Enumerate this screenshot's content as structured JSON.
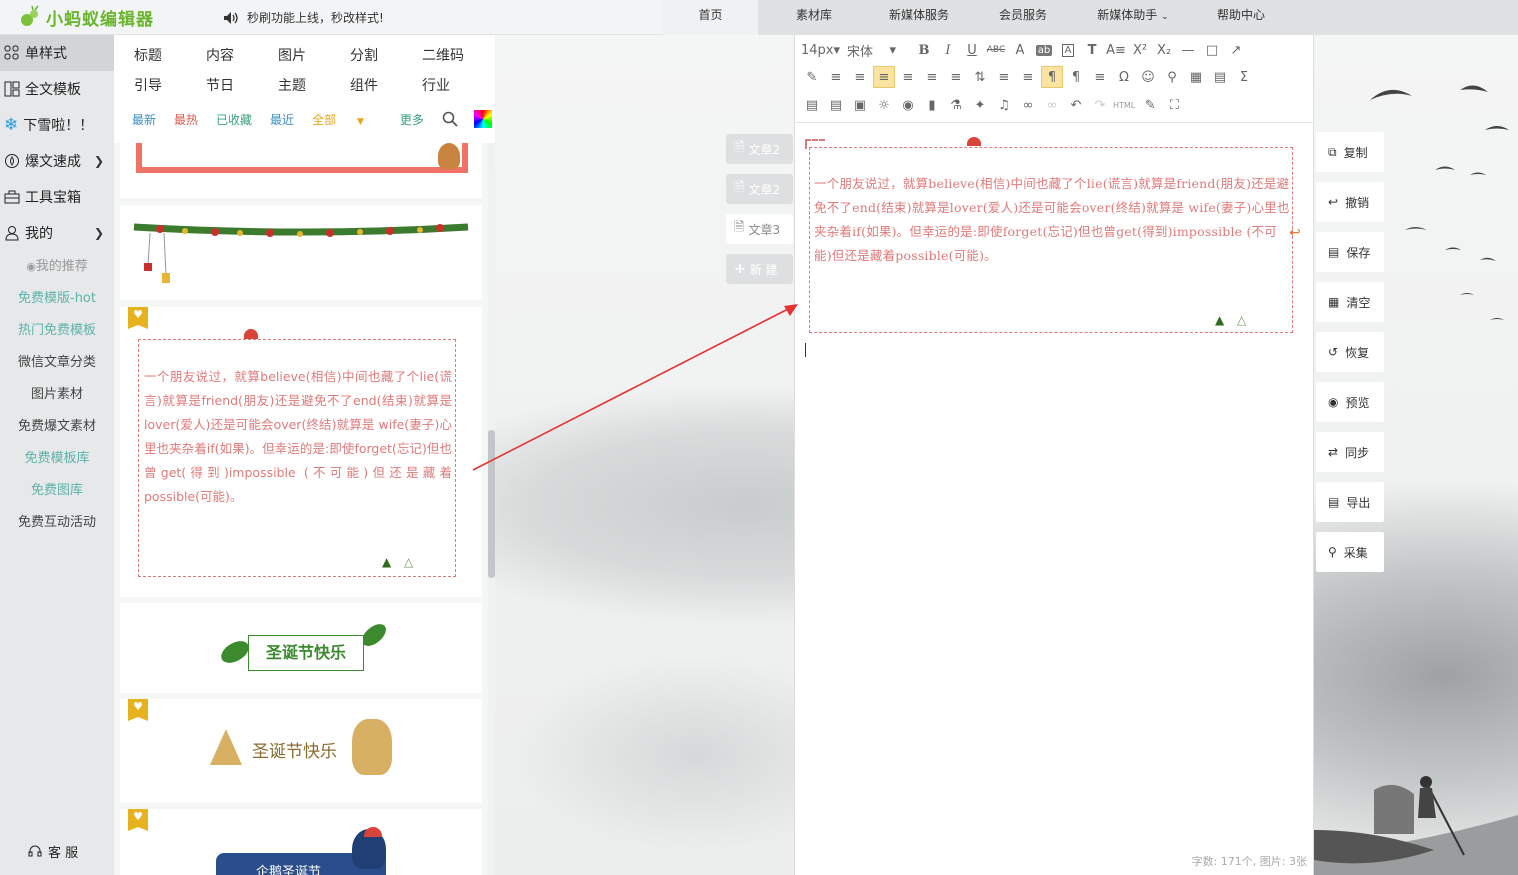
{
  "app": {
    "logo_text": "小蚂蚁编辑器",
    "notice": "秒刷功能上线，秒改样式!"
  },
  "nav": [
    {
      "label": "首页",
      "active": true
    },
    {
      "label": "素材库"
    },
    {
      "label": "新媒体服务"
    },
    {
      "label": "会员服务"
    },
    {
      "label": "新媒体助手",
      "has_dropdown": true
    },
    {
      "label": "帮助中心"
    }
  ],
  "leftnav": {
    "items": [
      {
        "label": "单样式",
        "icon": "grid-icon",
        "active": true
      },
      {
        "label": "全文模板",
        "icon": "template-icon"
      },
      {
        "label": "下雪啦！！",
        "icon": "snowflake-icon"
      },
      {
        "label": "爆文速成",
        "icon": "fire-icon",
        "chevron": true
      },
      {
        "label": "工具宝箱",
        "icon": "toolbox-icon"
      },
      {
        "label": "我的",
        "icon": "user-icon",
        "chevron": true
      }
    ],
    "subitems": [
      {
        "label": "我的推荐",
        "color": "#999999",
        "icon": "eye-icon"
      },
      {
        "label": "免费模版-hot",
        "color": "#5db3a8"
      },
      {
        "label": "热门免费模板",
        "color": "#5db3a8"
      },
      {
        "label": "微信文章分类",
        "color": "#444444"
      },
      {
        "label": "图片素材",
        "color": "#444444"
      },
      {
        "label": "免费爆文素材",
        "color": "#444444"
      },
      {
        "label": "免费模板库",
        "color": "#5db3a8"
      },
      {
        "label": "免费图库",
        "color": "#5db3a8"
      },
      {
        "label": "免费互动活动",
        "color": "#444444"
      }
    ],
    "service": "客 服"
  },
  "categories": [
    [
      "标题",
      "内容",
      "图片",
      "分割",
      "二维码"
    ],
    [
      "引导",
      "节日",
      "主题",
      "组件",
      "行业"
    ]
  ],
  "filters": [
    {
      "label": "最新",
      "color": "#3a8fc7"
    },
    {
      "label": "最热",
      "color": "#e05b4b"
    },
    {
      "label": "已收藏",
      "color": "#3aa17e"
    },
    {
      "label": "最近",
      "color": "#3a8fc7"
    },
    {
      "label": "全部",
      "color": "#e8a317",
      "dropdown": true
    },
    {
      "label": "更多",
      "color": "#3aa17e"
    }
  ],
  "article_text": "一个朋友说过，就算believe(相信)中间也藏了个lie(谎言)就算是friend(朋友)还是避免不了end(结束)就算是lover(爱人)还是可能会over(终结)就算是 wife(妻子)心里也夹杂着if(如果)。但幸运的是:即使forget(忘记)但也曾get(得到)impossible (不可能)但还是藏着possible(可能)。",
  "gallery": {
    "card5_text": "圣诞节快乐",
    "card6_text": "圣诞节快乐",
    "card7_text": "企鹅圣诞节"
  },
  "doc_tabs": [
    {
      "label": "文章2"
    },
    {
      "label": "文章2"
    },
    {
      "label": "文章3",
      "active": true
    },
    {
      "label": "新 建"
    }
  ],
  "toolbar": {
    "font_size": "14px",
    "font_family": "宋体",
    "html_label": "HTML"
  },
  "status": "字数: 171个, 图片: 3张",
  "actions": [
    {
      "label": "复制",
      "icon": "copy-icon"
    },
    {
      "label": "撤销",
      "icon": "undo-icon"
    },
    {
      "label": "保存",
      "icon": "save-icon"
    },
    {
      "label": "清空",
      "icon": "trash-icon"
    },
    {
      "label": "恢复",
      "icon": "restore-icon"
    },
    {
      "label": "预览",
      "icon": "eye-icon"
    },
    {
      "label": "同步",
      "icon": "sync-icon"
    },
    {
      "label": "导出",
      "icon": "export-icon"
    },
    {
      "label": "采集",
      "icon": "collect-icon"
    }
  ]
}
